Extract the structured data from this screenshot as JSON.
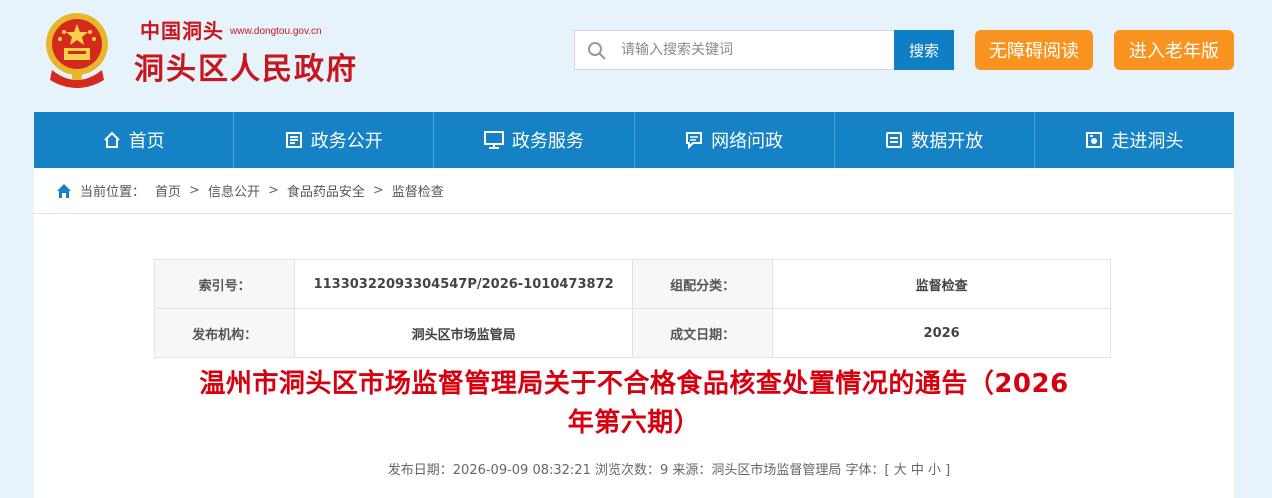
{
  "header": {
    "site_cn": "中国洞头",
    "site_url": "www.dongtou.gov.cn",
    "site_title": "洞头区人民政府",
    "search_placeholder": "请输入搜索关键词",
    "search_button": "搜索",
    "accessibility_button": "无障碍阅读",
    "elder_button": "进入老年版"
  },
  "nav": {
    "items": [
      {
        "label": "首页",
        "icon": "home-icon"
      },
      {
        "label": "政务公开",
        "icon": "document-icon"
      },
      {
        "label": "政务服务",
        "icon": "monitor-icon"
      },
      {
        "label": "网络问政",
        "icon": "message-icon"
      },
      {
        "label": "数据开放",
        "icon": "data-icon"
      },
      {
        "label": "走进洞头",
        "icon": "photo-icon"
      }
    ]
  },
  "breadcrumb": {
    "prefix": "当前位置：",
    "items": [
      "首页",
      "信息公开",
      "食品药品安全",
      "监督检查"
    ],
    "separator": ">"
  },
  "meta": {
    "index_label": "索引号：",
    "index_value": "11330322093304547P/2026-1010473872",
    "category_label": "组配分类：",
    "category_value": "监督检查",
    "publisher_label": "发布机构：",
    "publisher_value": "洞头区市场监管局",
    "date_label": "成文日期：",
    "date_value": "2026"
  },
  "article": {
    "title_line1": "温州市洞头区市场监督管理局关于不合格食品核查处置情况的通告（2026",
    "title_line2": "年第六期）",
    "info": "发布日期：2026-09-09 08:32:21 浏览次数：9 来源：洞头区市场监督管理局 字体：[ 大 中 小 ]"
  },
  "colors": {
    "brand_red": "#c8161d",
    "nav_blue": "#1582c6",
    "orange": "#f7931e",
    "title_red": "#d7000f"
  }
}
